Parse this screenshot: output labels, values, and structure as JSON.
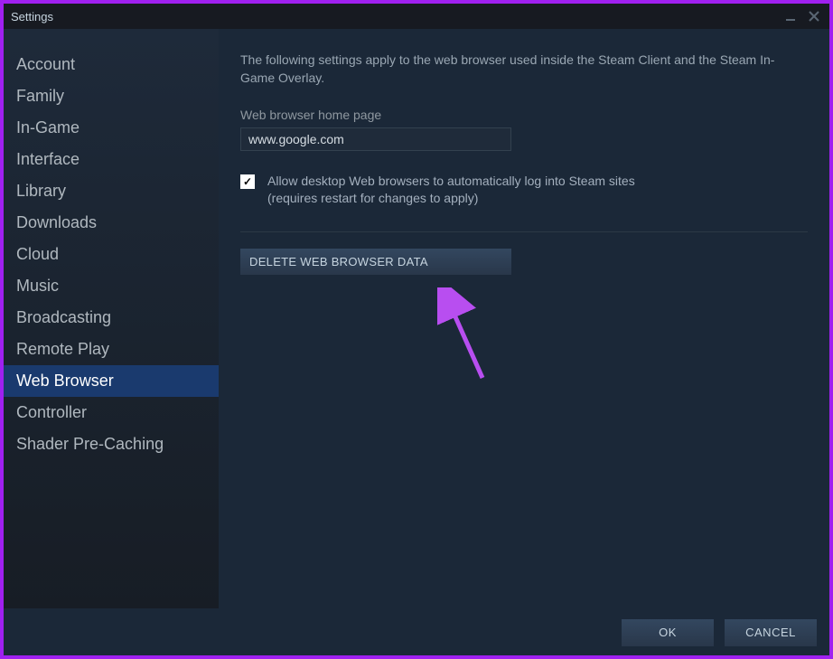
{
  "titlebar": {
    "title": "Settings"
  },
  "sidebar": {
    "items": [
      {
        "label": "Account",
        "active": false
      },
      {
        "label": "Family",
        "active": false
      },
      {
        "label": "In-Game",
        "active": false
      },
      {
        "label": "Interface",
        "active": false
      },
      {
        "label": "Library",
        "active": false
      },
      {
        "label": "Downloads",
        "active": false
      },
      {
        "label": "Cloud",
        "active": false
      },
      {
        "label": "Music",
        "active": false
      },
      {
        "label": "Broadcasting",
        "active": false
      },
      {
        "label": "Remote Play",
        "active": false
      },
      {
        "label": "Web Browser",
        "active": true
      },
      {
        "label": "Controller",
        "active": false
      },
      {
        "label": "Shader Pre-Caching",
        "active": false
      }
    ]
  },
  "content": {
    "description": "The following settings apply to the web browser used inside the Steam Client and the Steam In-Game Overlay.",
    "homepage_label": "Web browser home page",
    "homepage_value": "www.google.com",
    "checkbox_checked": true,
    "checkbox_line1": "Allow desktop Web browsers to automatically log into Steam sites",
    "checkbox_line2": "(requires restart for changes to apply)",
    "delete_button": "DELETE WEB BROWSER DATA"
  },
  "footer": {
    "ok_label": "OK",
    "cancel_label": "CANCEL"
  },
  "annotation": {
    "arrow_color": "#b84ef0"
  }
}
